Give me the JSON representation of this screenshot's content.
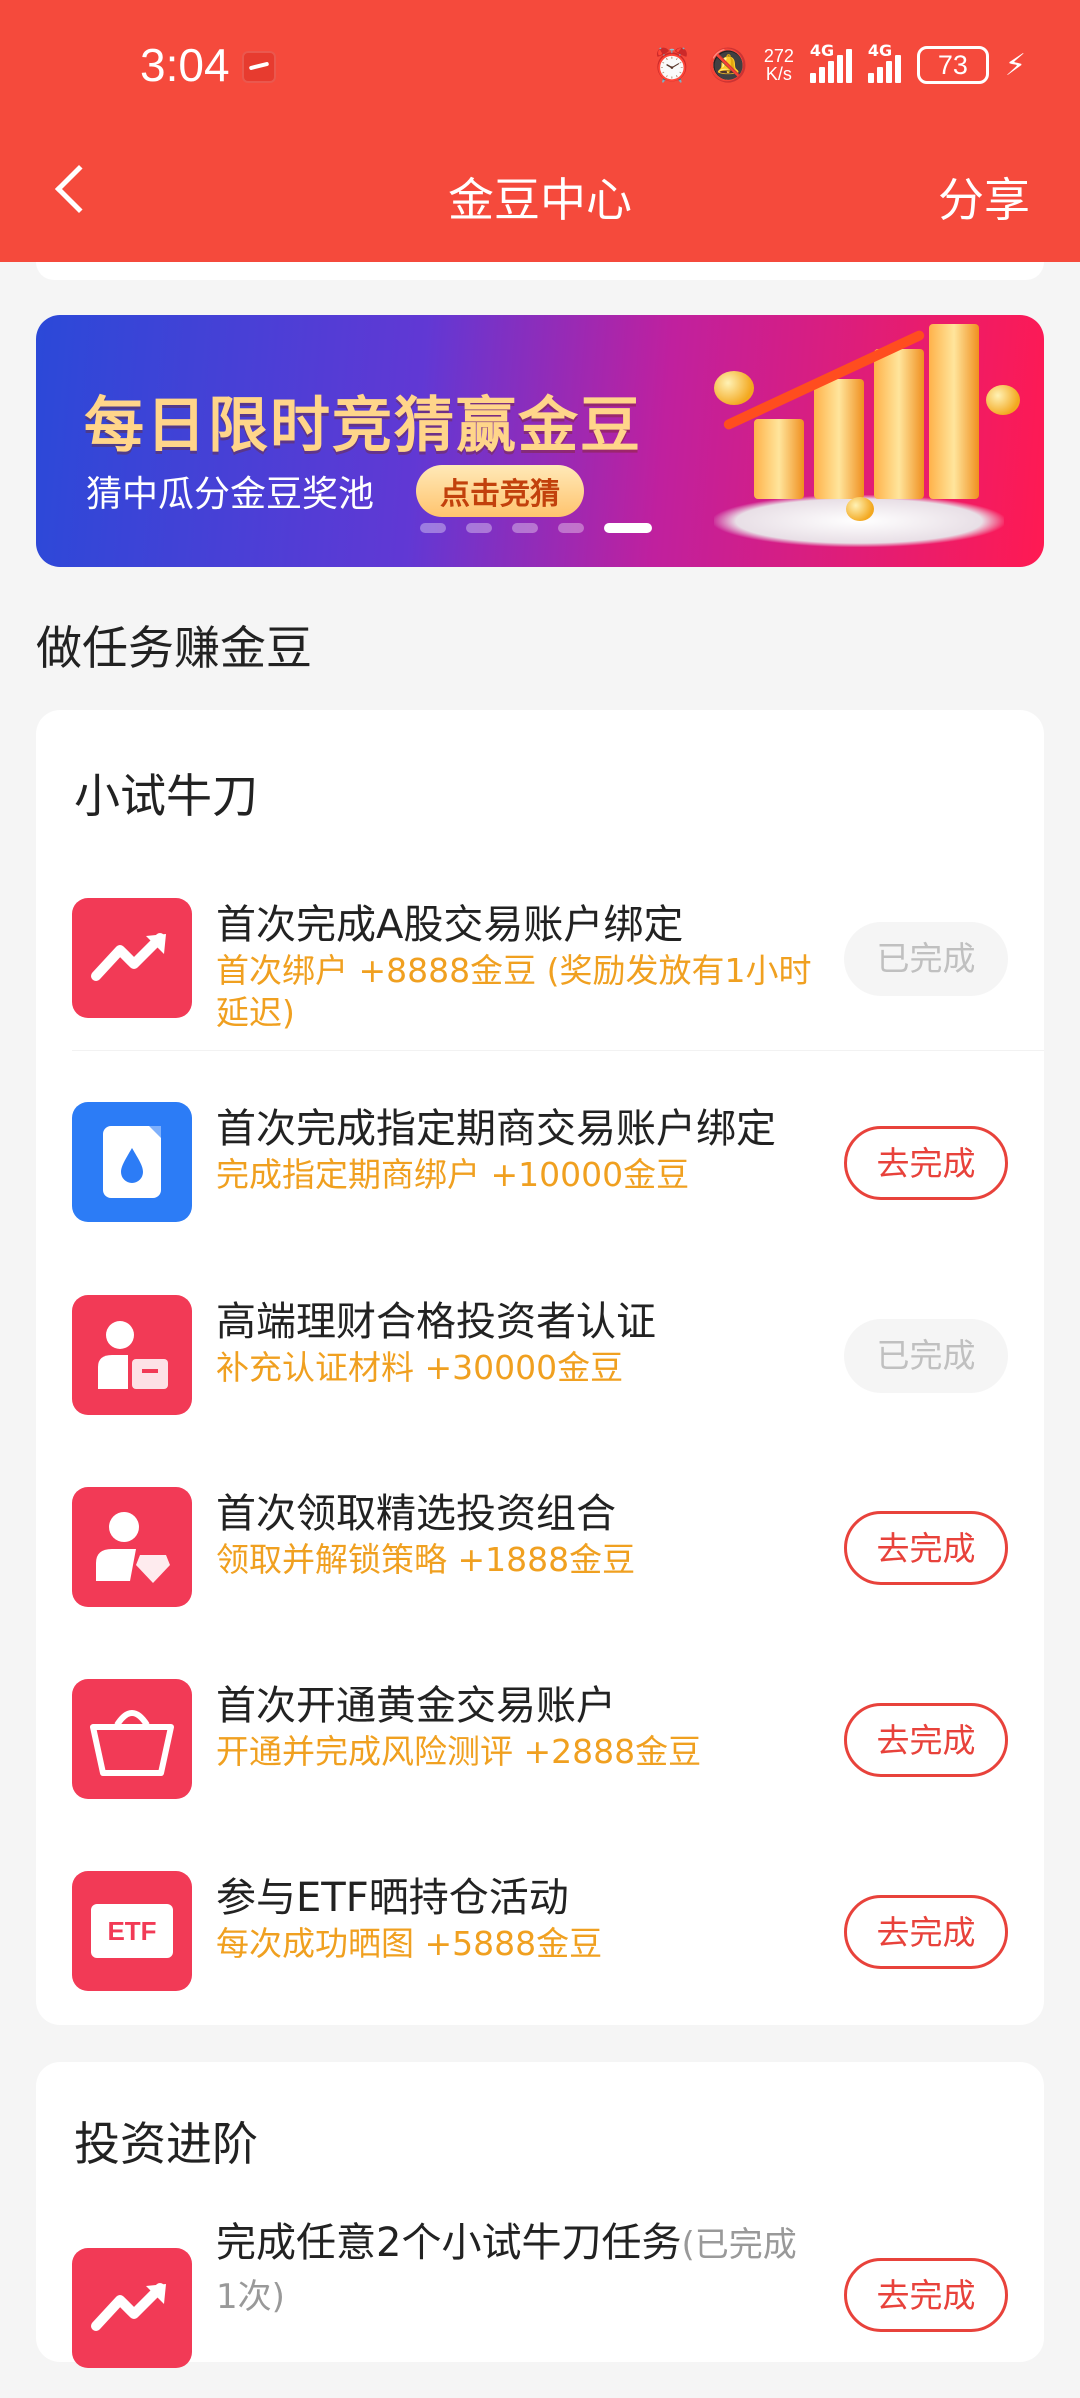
{
  "status_bar": {
    "time": "3:04",
    "net_speed": "272",
    "net_speed_unit": "K/s",
    "sim1": "4G",
    "sim2": "4G",
    "battery": "73"
  },
  "nav": {
    "title": "金豆中心",
    "share": "分享"
  },
  "banner": {
    "title": "每日限时竞猜赢金豆",
    "subtitle": "猜中瓜分金豆奖池",
    "cta": "点击竞猜"
  },
  "section_title": "做任务赚金豆",
  "cards": [
    {
      "title": "小试牛刀",
      "tasks": [
        {
          "name": "首次完成A股交易账户绑定",
          "reward": "首次绑户 +8888金豆 (奖励发放有1小时延迟)",
          "button": "已完成",
          "state": "done",
          "icon": "trend-icon"
        },
        {
          "name": "首次完成指定期商交易账户绑定",
          "reward": "完成指定期商绑户 +10000金豆",
          "button": "去完成",
          "state": "todo",
          "icon": "droplet-doc-icon"
        },
        {
          "name": "高端理财合格投资者认证",
          "reward": "补充认证材料 +30000金豆",
          "button": "已完成",
          "state": "done",
          "icon": "investor-card-icon"
        },
        {
          "name": "首次领取精选投资组合",
          "reward": "领取并解锁策略 +1888金豆",
          "button": "去完成",
          "state": "todo",
          "icon": "user-diamond-icon"
        },
        {
          "name": "首次开通黄金交易账户",
          "reward": "开通并完成风险测评 +2888金豆",
          "button": "去完成",
          "state": "todo",
          "icon": "basket-icon"
        },
        {
          "name": "参与ETF晒持仓活动",
          "reward": "每次成功晒图 +5888金豆",
          "button": "去完成",
          "state": "todo",
          "icon": "etf-icon",
          "icon_text": "ETF"
        }
      ]
    },
    {
      "title": "投资进阶",
      "tasks": [
        {
          "name": "完成任意2个小试牛刀任务",
          "name_note": "(已完成1次)",
          "button": "去完成",
          "state": "todo",
          "icon": "trend-icon"
        }
      ]
    }
  ],
  "colors": {
    "brand_red": "#f54a3c",
    "reward_orange": "#f0a020",
    "icon_red": "#f23a56",
    "icon_blue": "#2c7cf6"
  }
}
